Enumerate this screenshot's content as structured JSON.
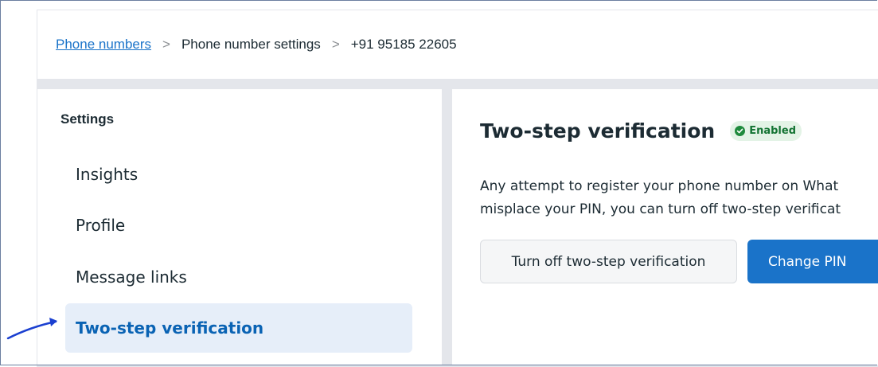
{
  "breadcrumb": {
    "items": [
      {
        "label": "Phone numbers",
        "link": true
      },
      {
        "label": "Phone number settings",
        "link": false
      },
      {
        "label": "+91 95185 22605",
        "link": false
      }
    ],
    "separator": ">"
  },
  "sidebar": {
    "heading": "Settings",
    "items": [
      {
        "label": "Insights",
        "active": false
      },
      {
        "label": "Profile",
        "active": false
      },
      {
        "label": "Message links",
        "active": false
      },
      {
        "label": "Two-step verification",
        "active": true
      }
    ]
  },
  "main": {
    "title": "Two-step verification",
    "status_badge": {
      "label": "Enabled",
      "icon": "check-circle-icon",
      "color": "#1e8a3c"
    },
    "description_line1": "Any attempt to register your phone number on What",
    "description_line2": "misplace your PIN, you can turn off two-step verificat",
    "buttons": {
      "turn_off": "Turn off two-step verification",
      "change_pin": "Change PIN"
    }
  },
  "colors": {
    "accent": "#1a73c9",
    "active_bg": "#e6eef9",
    "annotation": "#1a3fd0"
  }
}
